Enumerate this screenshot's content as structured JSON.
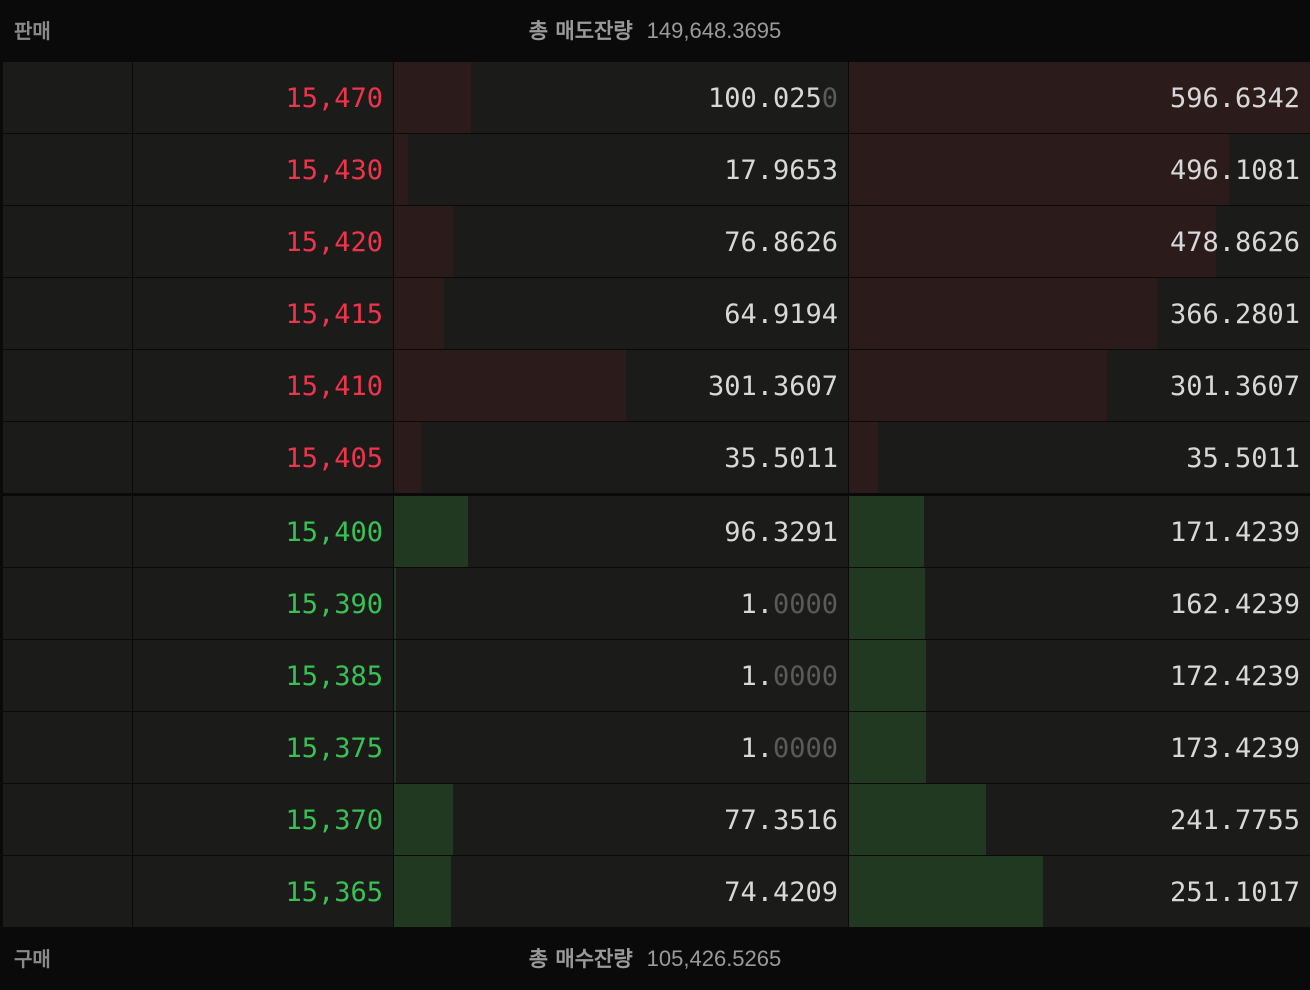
{
  "sell_header": {
    "label": "판매",
    "total_label": "총 매도잔량",
    "total_value": "149,648.3695"
  },
  "buy_header": {
    "label": "구매",
    "total_label": "총 매수잔량",
    "total_value": "105,426.5265"
  },
  "asks": [
    {
      "price": "15,470",
      "qty_main": "100.025",
      "qty_dim": "0",
      "qty_fill": 0.17,
      "cum_main": "596.6342",
      "cum_dim": "",
      "cum_fill": 1.0
    },
    {
      "price": "15,430",
      "qty_main": "17.9653",
      "qty_dim": "",
      "qty_fill": 0.03,
      "cum_main": "496.1081",
      "cum_dim": "",
      "cum_fill": 0.825
    },
    {
      "price": "15,420",
      "qty_main": "76.8626",
      "qty_dim": "",
      "qty_fill": 0.13,
      "cum_main": "478.8626",
      "cum_dim": "",
      "cum_fill": 0.797
    },
    {
      "price": "15,415",
      "qty_main": "64.9194",
      "qty_dim": "",
      "qty_fill": 0.11,
      "cum_main": "366.2801",
      "cum_dim": "",
      "cum_fill": 0.668
    },
    {
      "price": "15,410",
      "qty_main": "301.3607",
      "qty_dim": "",
      "qty_fill": 0.51,
      "cum_main": "301.3607",
      "cum_dim": "",
      "cum_fill": 0.56
    },
    {
      "price": "15,405",
      "qty_main": "35.5011",
      "qty_dim": "",
      "qty_fill": 0.06,
      "cum_main": "35.5011",
      "cum_dim": "",
      "cum_fill": 0.063
    }
  ],
  "bids": [
    {
      "price": "15,400",
      "qty_main": "96.3291",
      "qty_dim": "",
      "qty_fill": 0.163,
      "cum_main": "171.4239",
      "cum_dim": "",
      "cum_fill": 0.163
    },
    {
      "price": "15,390",
      "qty_main": "1.",
      "qty_dim": "0000",
      "qty_fill": 0.004,
      "cum_main": "162.4239",
      "cum_dim": "",
      "cum_fill": 0.165
    },
    {
      "price": "15,385",
      "qty_main": "1.",
      "qty_dim": "0000",
      "qty_fill": 0.004,
      "cum_main": "172.4239",
      "cum_dim": "",
      "cum_fill": 0.167
    },
    {
      "price": "15,375",
      "qty_main": "1.",
      "qty_dim": "0000",
      "qty_fill": 0.004,
      "cum_main": "173.4239",
      "cum_dim": "",
      "cum_fill": 0.167
    },
    {
      "price": "15,370",
      "qty_main": "77.3516",
      "qty_dim": "",
      "qty_fill": 0.13,
      "cum_main": "241.7755",
      "cum_dim": "",
      "cum_fill": 0.297
    },
    {
      "price": "15,365",
      "qty_main": "74.4209",
      "qty_dim": "",
      "qty_fill": 0.126,
      "cum_main": "251.1017",
      "cum_dim": "",
      "cum_fill": 0.42
    }
  ],
  "colors": {
    "ask_price": "#f0344e",
    "bid_price": "#38c255",
    "ask_bar": "#2b1b1b",
    "bid_bar": "#213821",
    "cell_bg": "#1b1b19"
  }
}
